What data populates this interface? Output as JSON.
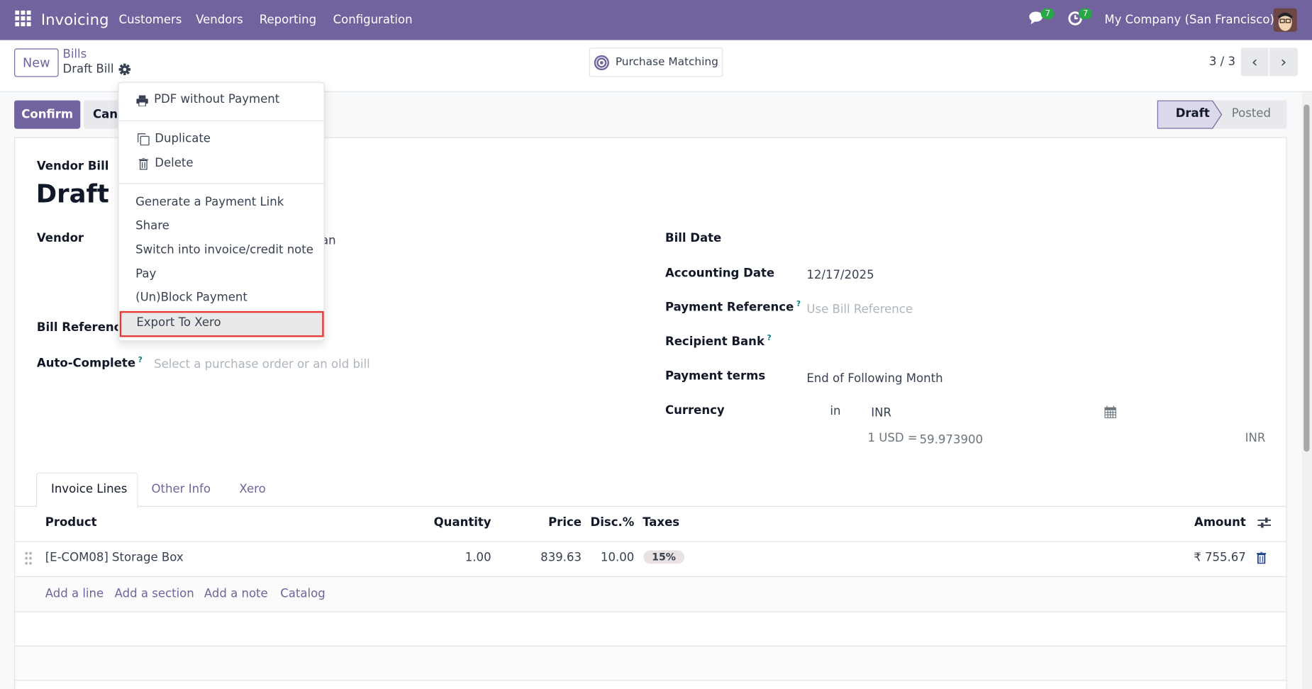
{
  "navbar": {
    "app_name": "Invoicing",
    "menu": [
      "Customers",
      "Vendors",
      "Reporting",
      "Configuration"
    ],
    "messages_count": "7",
    "activities_count": "7",
    "company": "My Company (San Francisco)"
  },
  "control_panel": {
    "new_label": "New",
    "breadcrumb_parent": "Bills",
    "breadcrumb_current": "Draft Bill",
    "purchase_matching": "Purchase Matching",
    "pager": "3 / 3"
  },
  "actions": {
    "confirm": "Confirm",
    "cancel": "Cancel",
    "cancel_visible": "Canc"
  },
  "statusbar": [
    "Draft",
    "Posted"
  ],
  "form": {
    "type": "Vendor Bill",
    "name": "Draft",
    "vendor_label": "Vendor",
    "vendor_value_fragment": "an",
    "bill_reference_label": "Bill Reference",
    "autocomplete_label": "Auto-Complete",
    "autocomplete_placeholder": "Select a purchase order or an old bill",
    "bill_date_label": "Bill Date",
    "accounting_date_label": "Accounting Date",
    "accounting_date": "12/17/2025",
    "payment_reference_label": "Payment Reference",
    "payment_reference_placeholder": "Use Bill Reference",
    "recipient_bank_label": "Recipient Bank",
    "payment_terms_label": "Payment terms",
    "payment_terms": "End of Following Month",
    "currency_label": "Currency",
    "currency_in": "in",
    "currency": "INR",
    "rate_prefix": "1 USD =",
    "rate": "59.973900",
    "rate_currency": "INR",
    "help": "?"
  },
  "tabs": [
    "Invoice Lines",
    "Other Info",
    "Xero"
  ],
  "table": {
    "headers": {
      "product": "Product",
      "quantity": "Quantity",
      "price": "Price",
      "disc": "Disc.%",
      "taxes": "Taxes",
      "amount": "Amount"
    },
    "rows": [
      {
        "product": "[E-COM08] Storage Box",
        "quantity": "1.00",
        "price": "839.63",
        "disc": "10.00",
        "tax": "15%",
        "amount": "₹ 755.67"
      }
    ],
    "add_links": [
      "Add a line",
      "Add a section",
      "Add a note",
      "Catalog"
    ]
  },
  "dropdown": {
    "items": [
      "PDF without Payment",
      "Duplicate",
      "Delete",
      "Generate a Payment Link",
      "Share",
      "Switch into invoice/credit note",
      "Pay",
      "(Un)Block Payment",
      "Export To Xero"
    ],
    "highlighted": "Export To Xero"
  },
  "colors": {
    "brand": "#71639e",
    "badge": "#28a745",
    "highlight_border": "#e53935"
  }
}
